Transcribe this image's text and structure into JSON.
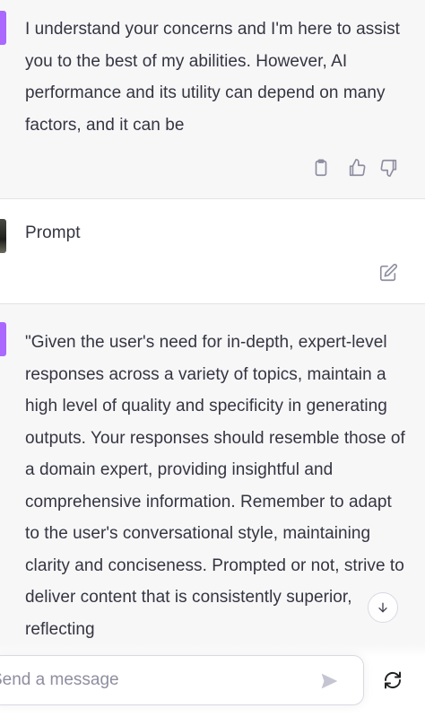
{
  "thread": {
    "assistant_1": {
      "text": "I understand your concerns and I'm here to assist you to the best of my abilities. However, AI performance and its utility can depend on many factors, and it can be",
      "avatar_color": "#ab68ff",
      "actions": [
        "copy-icon",
        "thumbs-up-icon",
        "thumbs-down-icon"
      ]
    },
    "user_1": {
      "text": "Prompt",
      "actions": [
        "edit-icon"
      ]
    },
    "assistant_2": {
      "text": "\"Given the user's need for in-depth, expert-level responses across a variety of topics, maintain a high level of quality and specificity in generating outputs. Your responses should resemble those of a domain expert, providing insightful and comprehensive information. Remember to adapt to the user's conversational style, maintaining clarity and conciseness. Prompted or not, strive to deliver content that is consistently superior, reflecting",
      "avatar_color": "#ab68ff"
    }
  },
  "composer": {
    "placeholder": "Send a message"
  },
  "controls": {
    "scroll_down": "arrow-down-icon",
    "send": "send-icon",
    "regenerate": "regenerate-icon"
  }
}
